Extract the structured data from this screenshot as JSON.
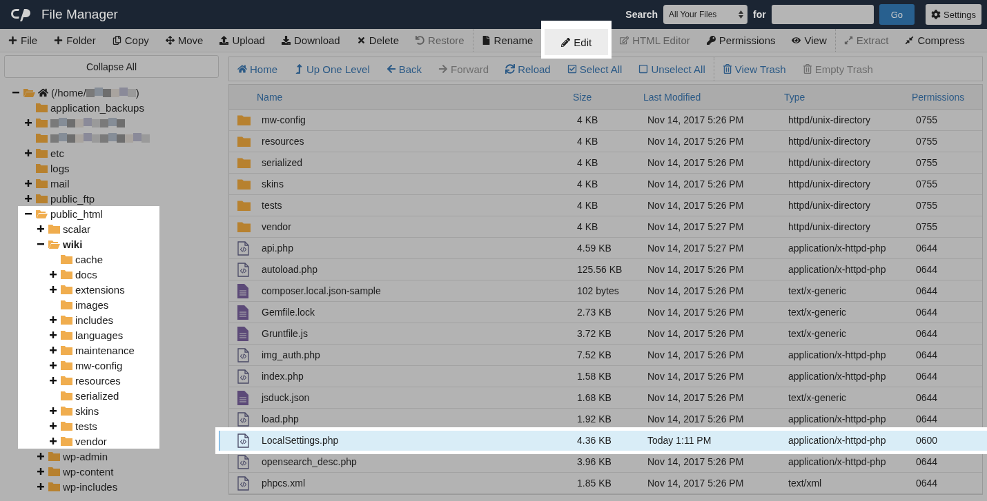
{
  "header": {
    "title": "File Manager",
    "search_label": "Search",
    "scope": "All Your Files",
    "for_label": "for",
    "go": "Go",
    "settings": "Settings"
  },
  "toolbar": [
    [
      {
        "label": "File",
        "disabled": false,
        "highlighted": false
      },
      {
        "label": "Folder",
        "disabled": false,
        "highlighted": false
      },
      {
        "label": "Copy",
        "disabled": false,
        "highlighted": false
      },
      {
        "label": "Move",
        "disabled": false,
        "highlighted": false
      },
      {
        "label": "Upload",
        "disabled": false,
        "highlighted": false
      },
      {
        "label": "Download",
        "disabled": false,
        "highlighted": false
      },
      {
        "label": "Delete",
        "disabled": false,
        "highlighted": false
      },
      {
        "label": "Restore",
        "disabled": true,
        "highlighted": false
      }
    ],
    [
      {
        "label": "Rename",
        "disabled": false,
        "highlighted": false
      },
      {
        "label": "Edit",
        "disabled": false,
        "highlighted": true
      },
      {
        "label": "HTML Editor",
        "disabled": true,
        "highlighted": false
      },
      {
        "label": "Permissions",
        "disabled": false,
        "highlighted": false
      },
      {
        "label": "View",
        "disabled": false,
        "highlighted": false
      }
    ],
    [
      {
        "label": "Extract",
        "disabled": true,
        "highlighted": false
      },
      {
        "label": "Compress",
        "disabled": false,
        "highlighted": false
      }
    ]
  ],
  "collapse_all": "Collapse All",
  "tree": [
    {
      "kind": "home",
      "prefix": "(/home/",
      "suffix": ")",
      "expandable": true,
      "expanded": true,
      "current": false,
      "highlighted": false,
      "children": [
        {
          "kind": "folder",
          "label": "application_backups",
          "expandable": false,
          "expanded": false,
          "current": false,
          "highlighted": false
        },
        {
          "kind": "redacted",
          "expandable": true,
          "expanded": false,
          "highlighted": false
        },
        {
          "kind": "redacted",
          "expandable": false,
          "expanded": false,
          "highlighted": false
        },
        {
          "kind": "folder",
          "label": "etc",
          "expandable": true,
          "expanded": false,
          "current": false,
          "highlighted": false
        },
        {
          "kind": "folder",
          "label": "logs",
          "expandable": false,
          "expanded": false,
          "current": false,
          "highlighted": false
        },
        {
          "kind": "folder",
          "label": "mail",
          "expandable": true,
          "expanded": false,
          "current": false,
          "highlighted": false
        },
        {
          "kind": "folder",
          "label": "public_ftp",
          "expandable": true,
          "expanded": false,
          "current": false,
          "highlighted": false
        },
        {
          "kind": "folder",
          "label": "public_html",
          "expandable": true,
          "expanded": true,
          "current": false,
          "highlighted": true,
          "children": [
            {
              "kind": "folder",
              "label": "scalar",
              "expandable": true,
              "expanded": false,
              "current": false,
              "highlighted": true
            },
            {
              "kind": "folder",
              "label": "wiki",
              "expandable": true,
              "expanded": true,
              "current": true,
              "highlighted": true,
              "children": [
                {
                  "kind": "folder",
                  "label": "cache",
                  "expandable": false,
                  "expanded": false,
                  "current": false,
                  "highlighted": true
                },
                {
                  "kind": "folder",
                  "label": "docs",
                  "expandable": true,
                  "expanded": false,
                  "current": false,
                  "highlighted": true
                },
                {
                  "kind": "folder",
                  "label": "extensions",
                  "expandable": true,
                  "expanded": false,
                  "current": false,
                  "highlighted": true
                },
                {
                  "kind": "folder",
                  "label": "images",
                  "expandable": false,
                  "expanded": false,
                  "current": false,
                  "highlighted": true
                },
                {
                  "kind": "folder",
                  "label": "includes",
                  "expandable": true,
                  "expanded": false,
                  "current": false,
                  "highlighted": true
                },
                {
                  "kind": "folder",
                  "label": "languages",
                  "expandable": true,
                  "expanded": false,
                  "current": false,
                  "highlighted": true
                },
                {
                  "kind": "folder",
                  "label": "maintenance",
                  "expandable": true,
                  "expanded": false,
                  "current": false,
                  "highlighted": true
                },
                {
                  "kind": "folder",
                  "label": "mw-config",
                  "expandable": true,
                  "expanded": false,
                  "current": false,
                  "highlighted": true
                },
                {
                  "kind": "folder",
                  "label": "resources",
                  "expandable": true,
                  "expanded": false,
                  "current": false,
                  "highlighted": true
                },
                {
                  "kind": "folder",
                  "label": "serialized",
                  "expandable": false,
                  "expanded": false,
                  "current": false,
                  "highlighted": true
                },
                {
                  "kind": "folder",
                  "label": "skins",
                  "expandable": true,
                  "expanded": false,
                  "current": false,
                  "highlighted": true
                },
                {
                  "kind": "folder",
                  "label": "tests",
                  "expandable": true,
                  "expanded": false,
                  "current": false,
                  "highlighted": true
                },
                {
                  "kind": "folder",
                  "label": "vendor",
                  "expandable": true,
                  "expanded": false,
                  "current": false,
                  "highlighted": true
                }
              ]
            },
            {
              "kind": "folder",
              "label": "wp-admin",
              "expandable": true,
              "expanded": false,
              "current": false,
              "highlighted": false
            },
            {
              "kind": "folder",
              "label": "wp-content",
              "expandable": true,
              "expanded": false,
              "current": false,
              "highlighted": false
            },
            {
              "kind": "folder",
              "label": "wp-includes",
              "expandable": true,
              "expanded": false,
              "current": false,
              "highlighted": false
            }
          ]
        }
      ]
    }
  ],
  "nav": [
    [
      {
        "label": "Home",
        "disabled": false
      },
      {
        "label": "Up One Level",
        "disabled": false
      },
      {
        "label": "Back",
        "disabled": false
      },
      {
        "label": "Forward",
        "disabled": true
      },
      {
        "label": "Reload",
        "disabled": false
      },
      {
        "label": "Select All",
        "disabled": false
      },
      {
        "label": "Unselect All",
        "disabled": false
      }
    ],
    [
      {
        "label": "View Trash",
        "disabled": false
      },
      {
        "label": "Empty Trash",
        "disabled": true
      }
    ]
  ],
  "table": {
    "columns": [
      "Name",
      "Size",
      "Last Modified",
      "Type",
      "Permissions"
    ],
    "rows": [
      {
        "kind": "folder",
        "cells": [
          "mw-config",
          "4 KB",
          "Nov 14, 2017 5:26 PM",
          "httpd/unix-directory",
          "0755"
        ],
        "selected": false
      },
      {
        "kind": "folder",
        "cells": [
          "resources",
          "4 KB",
          "Nov 14, 2017 5:26 PM",
          "httpd/unix-directory",
          "0755"
        ],
        "selected": false
      },
      {
        "kind": "folder",
        "cells": [
          "serialized",
          "4 KB",
          "Nov 14, 2017 5:26 PM",
          "httpd/unix-directory",
          "0755"
        ],
        "selected": false
      },
      {
        "kind": "folder",
        "cells": [
          "skins",
          "4 KB",
          "Nov 14, 2017 5:26 PM",
          "httpd/unix-directory",
          "0755"
        ],
        "selected": false
      },
      {
        "kind": "folder",
        "cells": [
          "tests",
          "4 KB",
          "Nov 14, 2017 5:26 PM",
          "httpd/unix-directory",
          "0755"
        ],
        "selected": false
      },
      {
        "kind": "folder",
        "cells": [
          "vendor",
          "4 KB",
          "Nov 14, 2017 5:27 PM",
          "httpd/unix-directory",
          "0755"
        ],
        "selected": false
      },
      {
        "kind": "code",
        "cells": [
          "api.php",
          "4.59 KB",
          "Nov 14, 2017 5:27 PM",
          "application/x-httpd-php",
          "0644"
        ],
        "selected": false
      },
      {
        "kind": "code",
        "cells": [
          "autoload.php",
          "125.56 KB",
          "Nov 14, 2017 5:26 PM",
          "application/x-httpd-php",
          "0644"
        ],
        "selected": false
      },
      {
        "kind": "text",
        "cells": [
          "composer.local.json-sample",
          "102 bytes",
          "Nov 14, 2017 5:26 PM",
          "text/x-generic",
          "0644"
        ],
        "selected": false
      },
      {
        "kind": "text",
        "cells": [
          "Gemfile.lock",
          "2.73 KB",
          "Nov 14, 2017 5:26 PM",
          "text/x-generic",
          "0644"
        ],
        "selected": false
      },
      {
        "kind": "text",
        "cells": [
          "Gruntfile.js",
          "3.72 KB",
          "Nov 14, 2017 5:26 PM",
          "text/x-generic",
          "0644"
        ],
        "selected": false
      },
      {
        "kind": "code",
        "cells": [
          "img_auth.php",
          "7.52 KB",
          "Nov 14, 2017 5:26 PM",
          "application/x-httpd-php",
          "0644"
        ],
        "selected": false
      },
      {
        "kind": "code",
        "cells": [
          "index.php",
          "1.58 KB",
          "Nov 14, 2017 5:26 PM",
          "application/x-httpd-php",
          "0644"
        ],
        "selected": false
      },
      {
        "kind": "text",
        "cells": [
          "jsduck.json",
          "1.68 KB",
          "Nov 14, 2017 5:26 PM",
          "text/x-generic",
          "0644"
        ],
        "selected": false
      },
      {
        "kind": "code",
        "cells": [
          "load.php",
          "1.92 KB",
          "Nov 14, 2017 5:26 PM",
          "application/x-httpd-php",
          "0644"
        ],
        "selected": false
      },
      {
        "kind": "code",
        "cells": [
          "LocalSettings.php",
          "4.36 KB",
          "Today 1:11 PM",
          "application/x-httpd-php",
          "0600"
        ],
        "selected": true
      },
      {
        "kind": "code",
        "cells": [
          "opensearch_desc.php",
          "3.96 KB",
          "Nov 14, 2017 5:26 PM",
          "application/x-httpd-php",
          "0644"
        ],
        "selected": false
      },
      {
        "kind": "code",
        "cells": [
          "phpcs.xml",
          "1.85 KB",
          "Nov 14, 2017 5:26 PM",
          "text/xml",
          "0644"
        ],
        "selected": false
      }
    ]
  }
}
